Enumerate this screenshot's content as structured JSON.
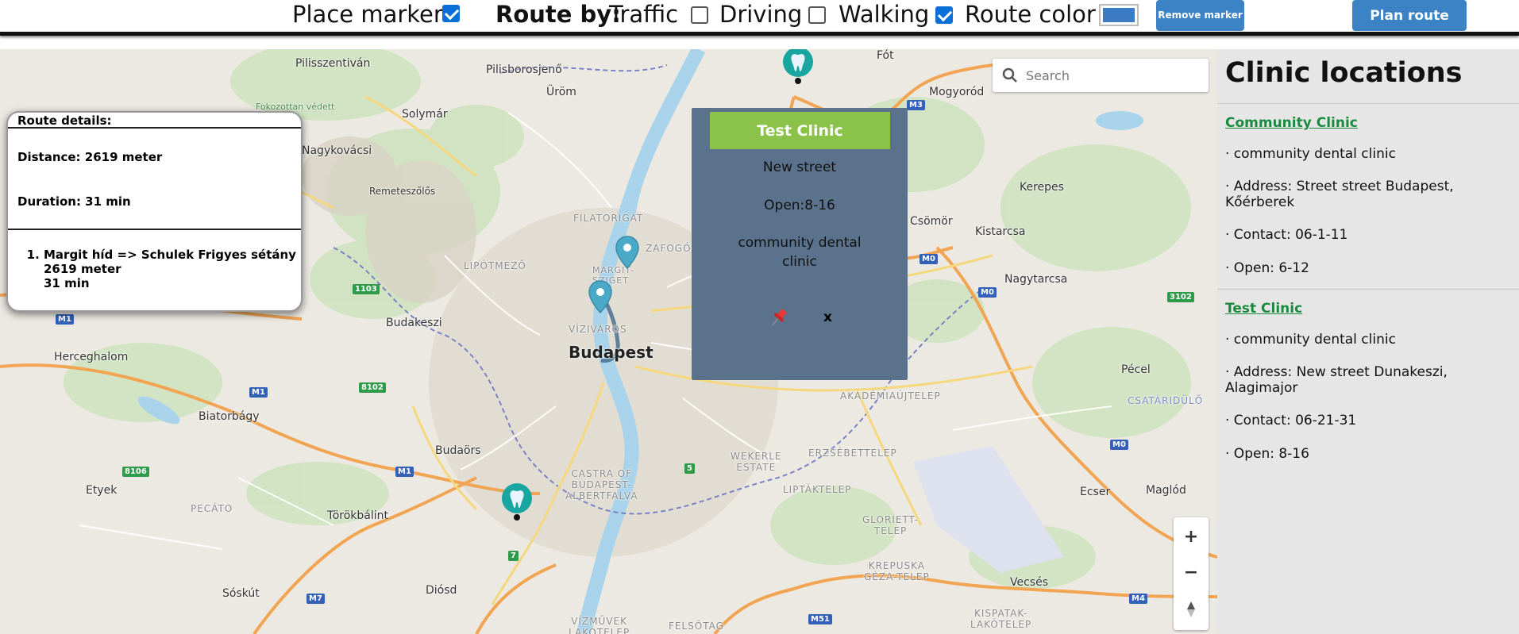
{
  "toolbar": {
    "place_marker_label": "Place marker",
    "place_marker_checked": true,
    "route_by_label": "Route by:",
    "traffic_label": "Traffic",
    "traffic_checked": false,
    "driving_label": "Driving",
    "driving_checked": false,
    "walking_label": "Walking",
    "walking_checked": true,
    "route_color_label": "Route color",
    "route_color_value": "#3a7bc4",
    "remove_marker_label": "Remove marker",
    "plan_route_label": "Plan route"
  },
  "search": {
    "placeholder": "Search"
  },
  "route_details": {
    "header": "Route details:",
    "distance": "Distance: 2619 meter",
    "duration": "Duration: 31 min",
    "steps": [
      {
        "name": "Margit híd => Schulek Frigyes sétány",
        "distance": "2619 meter",
        "duration": "31 min"
      }
    ]
  },
  "popup": {
    "title": "Test Clinic",
    "street": "New street",
    "hours": "Open:8-16",
    "type": "community dental clinic",
    "pin_icon": "pushpin-icon",
    "close_label": "x"
  },
  "map": {
    "labels": {
      "pilisszentivan": "Pilisszentiván",
      "pilisborosjeno": "Pilisborosjenő",
      "urom": "Üröm",
      "fot": "Fót",
      "mogyorod": "Mogyoród",
      "solymar": "Solymár",
      "nagykovacsi": "Nagykovácsi",
      "remeteszolos": "Remeteszőlős",
      "kerepes": "Kerepes",
      "csomor": "Csömör",
      "kistarcsa": "Kistarcsa",
      "nagytarcsa": "Nagytarcsa",
      "budakeszi": "Budakeszi",
      "herceghalom": "Herceghalom",
      "budapest": "Budapest",
      "biatorbagy": "Biatorbágy",
      "budaors": "Budaörs",
      "pecel": "Pécel",
      "etyek": "Etyek",
      "torokbalint": "Törökbálint",
      "ecser": "Ecser",
      "maglod": "Maglód",
      "sosku": "Sóskút",
      "diosd": "Diósd",
      "vecses": "Vecsés",
      "filatorigat": "FILATORIGÁT",
      "lipotmezo": "LIPÓTMEZŐ",
      "margit_island": "MARGIT-\nSZIGET",
      "vizivaros": "VÍZIVÁROS",
      "castra": "CASTRA OF\nBUDAPEST-\nALBERTFALVA",
      "wekerle": "WEKERLE\nESTATE",
      "erzsebettelep": "ERZSÉBETTELEP",
      "akademiaujtelep": "AKADÉMIAÚJTELEP",
      "liptaktelep": "LIPTÁKTELEP",
      "gloriett": "GLORIETT-\nTELEP",
      "krepuska": "KREPUSKA\nGÉZA-TELEP",
      "csatariduio": "CSATÁRIDÜLŐ",
      "pecato": "PECÁTO",
      "kispatak": "KISPATAK-\nLAKÓTELEP",
      "felsotag": "FELSŐTAG",
      "vizmuvek": "VÍZMŰVEK\nLAKÓTELEP",
      "fokozottan": "Fokozottan védett\nterület",
      "zafogo": "ZAFOGÓ"
    },
    "road_badges": [
      "M1",
      "M1",
      "M1",
      "M0",
      "M0",
      "M0",
      "M3",
      "M4",
      "M51",
      "M7",
      "1103",
      "8102",
      "8106",
      "3102",
      "5",
      "7"
    ]
  },
  "zoom": {
    "in_label": "+",
    "out_label": "−",
    "compass_icon": "compass-icon"
  },
  "sidebar": {
    "title": "Clinic locations",
    "clinics": [
      {
        "name": "Community Clinic",
        "type": "· community dental clinic",
        "address": "· Address: Street street Budapest, Kőérberek",
        "contact": "· Contact: 06-1-11",
        "open": "· Open: 6-12"
      },
      {
        "name": "Test Clinic",
        "type": "· community dental clinic",
        "address": "· Address: New street Dunakeszi, Alagimajor",
        "contact": "· Contact: 06-21-31",
        "open": "· Open: 8-16"
      }
    ]
  },
  "colors": {
    "accent_blue": "#3b83c4",
    "popup_bg": "#5a728b",
    "popup_title_bg": "#8bc34a",
    "clinic_link": "#1a8a3f",
    "marker_teal": "#1aa6a0",
    "route_pin": "#4aa9c6"
  }
}
